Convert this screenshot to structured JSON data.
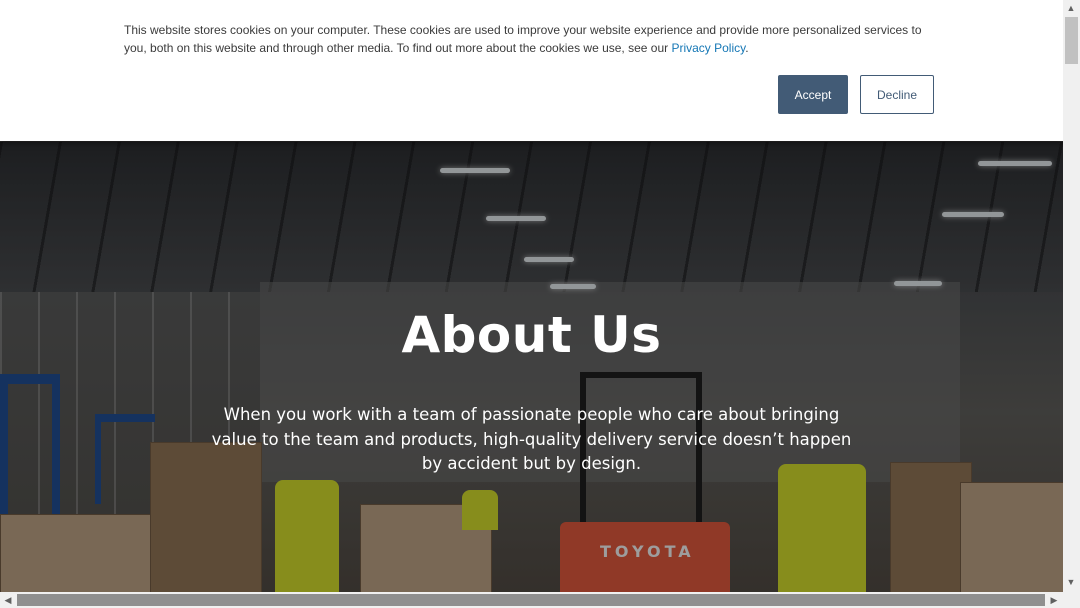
{
  "cookie_banner": {
    "text": "This website stores cookies on your computer. These cookies are used to improve your website experience and provide more personalized services to you, both on this website and through other media. To find out more about the cookies we use, see our ",
    "link_label": "Privacy Policy",
    "period": ".",
    "accept_label": "Accept",
    "decline_label": "Decline"
  },
  "hero": {
    "title": "About Us",
    "text": "When you work with a team of passionate people who care about bringing value to the team and products, high-quality delivery service doesn’t happen by accident but by design.",
    "forklift_text": "TOYOTA"
  },
  "scrollbar": {
    "up_arrow": "▲",
    "down_arrow": "▼",
    "left_arrow": "◀",
    "right_arrow": "▶"
  },
  "colors": {
    "accent": "#425b76",
    "link": "#1577b5"
  }
}
